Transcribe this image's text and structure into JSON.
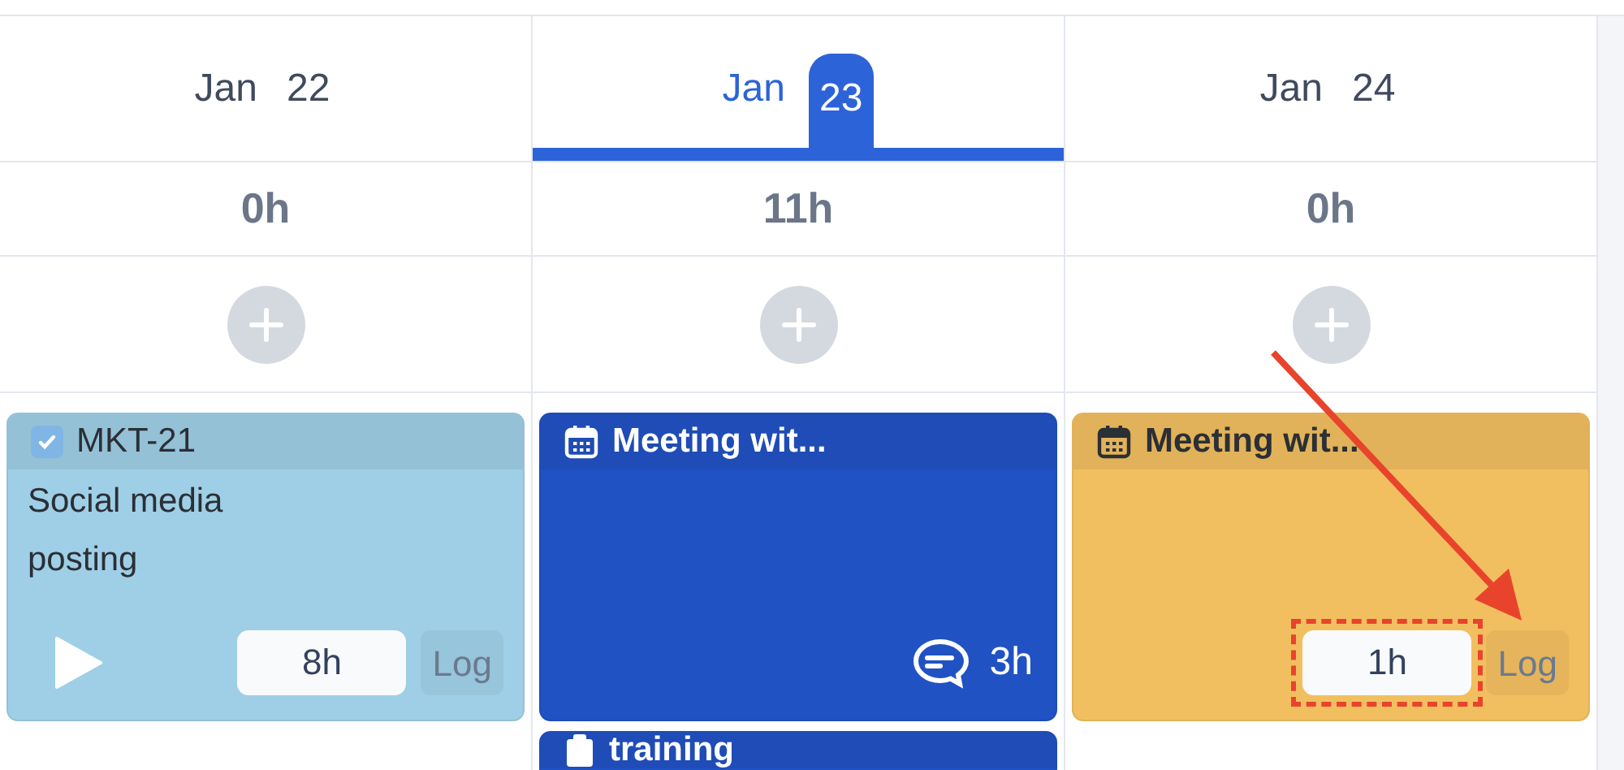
{
  "days": [
    {
      "month": "Jan",
      "day": "22",
      "selected": false,
      "total": "0h",
      "cards": [
        {
          "kind": "task",
          "color": "#9fcfe6",
          "checked": true,
          "key": "MKT-21",
          "summary": "Social media posting",
          "hours": "8h",
          "log": "Log"
        }
      ]
    },
    {
      "month": "Jan",
      "day": "23",
      "selected": true,
      "total": "11h",
      "cards": [
        {
          "kind": "event",
          "color": "#2152c4",
          "title": "Meeting wit...",
          "duration": "3h"
        },
        {
          "kind": "todo",
          "color": "#2152c4",
          "title": "training"
        }
      ]
    },
    {
      "month": "Jan",
      "day": "24",
      "selected": false,
      "total": "0h",
      "cards": [
        {
          "kind": "event",
          "color": "#f2bf60",
          "title": "Meeting wit...",
          "hours": "1h",
          "log": "Log",
          "highlighted": true
        }
      ]
    }
  ],
  "annotation": {
    "arrow": true
  }
}
